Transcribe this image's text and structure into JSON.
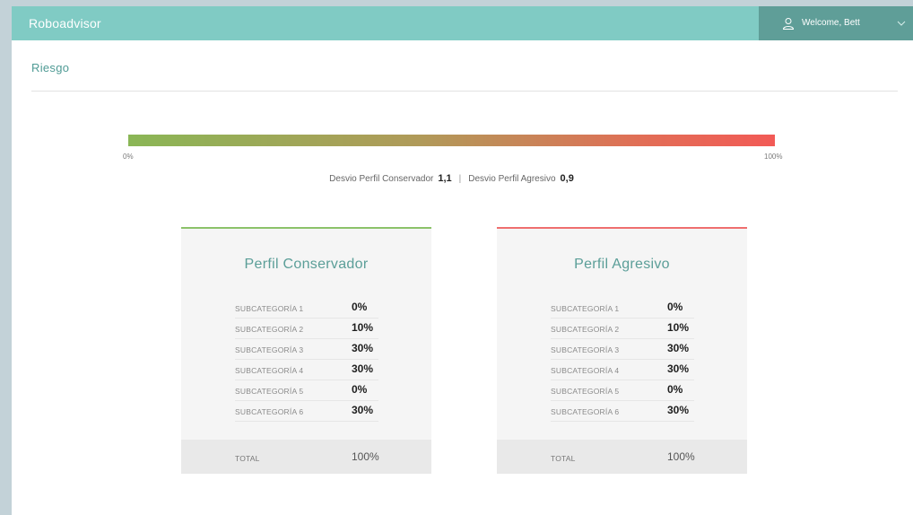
{
  "app": {
    "brand": "Roboadvisor",
    "user_label": "Welcome, Bett"
  },
  "page": {
    "title": "Riesgo"
  },
  "risk_bar": {
    "min_label": "0%",
    "max_label": "100%",
    "gradient_colors": [
      "#8ab656",
      "#b09a59",
      "#e26d56",
      "#f25a56"
    ]
  },
  "deviation": {
    "conservador_label": "Desvio Perfil Conservador",
    "conservador_value": "1,1",
    "separator": "|",
    "agresivo_label": "Desvio Perfil Agresivo",
    "agresivo_value": "0,9"
  },
  "profiles": [
    {
      "title": "Perfil Conservador",
      "accent": "#8cc26a",
      "rows": [
        {
          "label": "SUBCATEGORÍA 1",
          "value": "0%"
        },
        {
          "label": "SUBCATEGORÍA 2",
          "value": "10%"
        },
        {
          "label": "SUBCATEGORÍA 3",
          "value": "30%"
        },
        {
          "label": "SUBCATEGORÍA 4",
          "value": "30%"
        },
        {
          "label": "SUBCATEGORÍA 5",
          "value": "0%"
        },
        {
          "label": "SUBCATEGORÍA 6",
          "value": "30%"
        }
      ],
      "total_label": "TOTAL",
      "total_value": "100%"
    },
    {
      "title": "Perfil Agresivo",
      "accent": "#ef6f6f",
      "rows": [
        {
          "label": "SUBCATEGORÍA 1",
          "value": "0%"
        },
        {
          "label": "SUBCATEGORÍA 2",
          "value": "10%"
        },
        {
          "label": "SUBCATEGORÍA 3",
          "value": "30%"
        },
        {
          "label": "SUBCATEGORÍA 4",
          "value": "30%"
        },
        {
          "label": "SUBCATEGORÍA 5",
          "value": "0%"
        },
        {
          "label": "SUBCATEGORÍA 6",
          "value": "30%"
        }
      ],
      "total_label": "TOTAL",
      "total_value": "100%"
    }
  ],
  "colors": {
    "topbar": "#80cbc4",
    "user_menu": "#5f9e98",
    "title_text": "#4f9b95"
  },
  "icons": {
    "user": "user-icon",
    "menu_toggle": "chevron-down-icon"
  }
}
